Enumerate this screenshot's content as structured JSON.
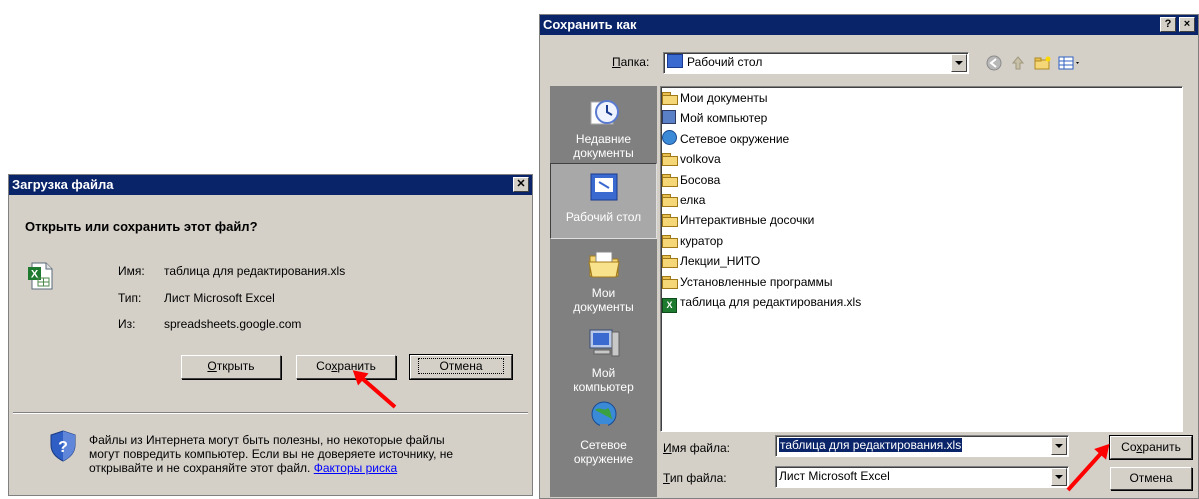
{
  "download_dialog": {
    "title": "Загрузка файла",
    "question": "Открыть или сохранить этот файл?",
    "name_label": "Имя:",
    "name_value": "таблица для редактирования.xls",
    "type_label": "Тип:",
    "type_value": "Лист Microsoft Excel",
    "from_label": "Из:",
    "from_value": "spreadsheets.google.com",
    "open_button_first": "О",
    "open_button_rest": "ткрыть",
    "save_button_first": "Со",
    "save_button_u": "х",
    "save_button_rest": "ранить",
    "cancel_button": "Отмена",
    "warning_line1": "Файлы из Интернета могут быть полезны, но некоторые файлы",
    "warning_line2": "могут повредить компьютер. Если вы не доверяете источнику, не",
    "warning_line3": "открывайте и не сохраняйте этот файл.",
    "risk_link": "Факторы риска"
  },
  "save_dialog": {
    "title": "Сохранить как",
    "help_button": "?",
    "close_button": "×",
    "folder_label_u": "П",
    "folder_label_rest": "апка:",
    "folder_value": "Рабочий стол",
    "places": [
      {
        "line1": "Недавние",
        "line2": "документы"
      },
      {
        "line1": "Рабочий стол",
        "line2": ""
      },
      {
        "line1": "Мои",
        "line2": "документы"
      },
      {
        "line1": "Мой",
        "line2": "компьютер"
      },
      {
        "line1": "Сетевое",
        "line2": "окружение"
      }
    ],
    "files": [
      "Мои документы",
      "Мой компьютер",
      "Сетевое окружение",
      "volkova",
      "Босова",
      "елка",
      "Интерактивные досочки",
      "куратор",
      "Лекции_НИТО",
      "Установленные программы",
      "таблица для редактирования.xls"
    ],
    "filename_label_u": "И",
    "filename_label_rest": "мя файла:",
    "filename_value": "таблица для редактирования.xls",
    "filetype_label_u": "Т",
    "filetype_label_rest": "ип файла:",
    "filetype_value": "Лист Microsoft Excel",
    "save_button_first": "Со",
    "save_button_u": "х",
    "save_button_rest": "ранить",
    "cancel_button": "Отмена"
  },
  "icons": {
    "excel": "excel-file-icon",
    "shield": "security-shield-icon",
    "desktop": "desktop-icon",
    "back": "back-arrow-icon",
    "up": "up-folder-icon",
    "new_folder": "new-folder-icon",
    "views": "views-menu-icon"
  },
  "colors": {
    "titlebar": "#0a246a",
    "dialog_bg": "#d4d0c8",
    "places_bg": "#808080",
    "selection": "#0a246a",
    "annotation_arrow": "#ff0000"
  }
}
